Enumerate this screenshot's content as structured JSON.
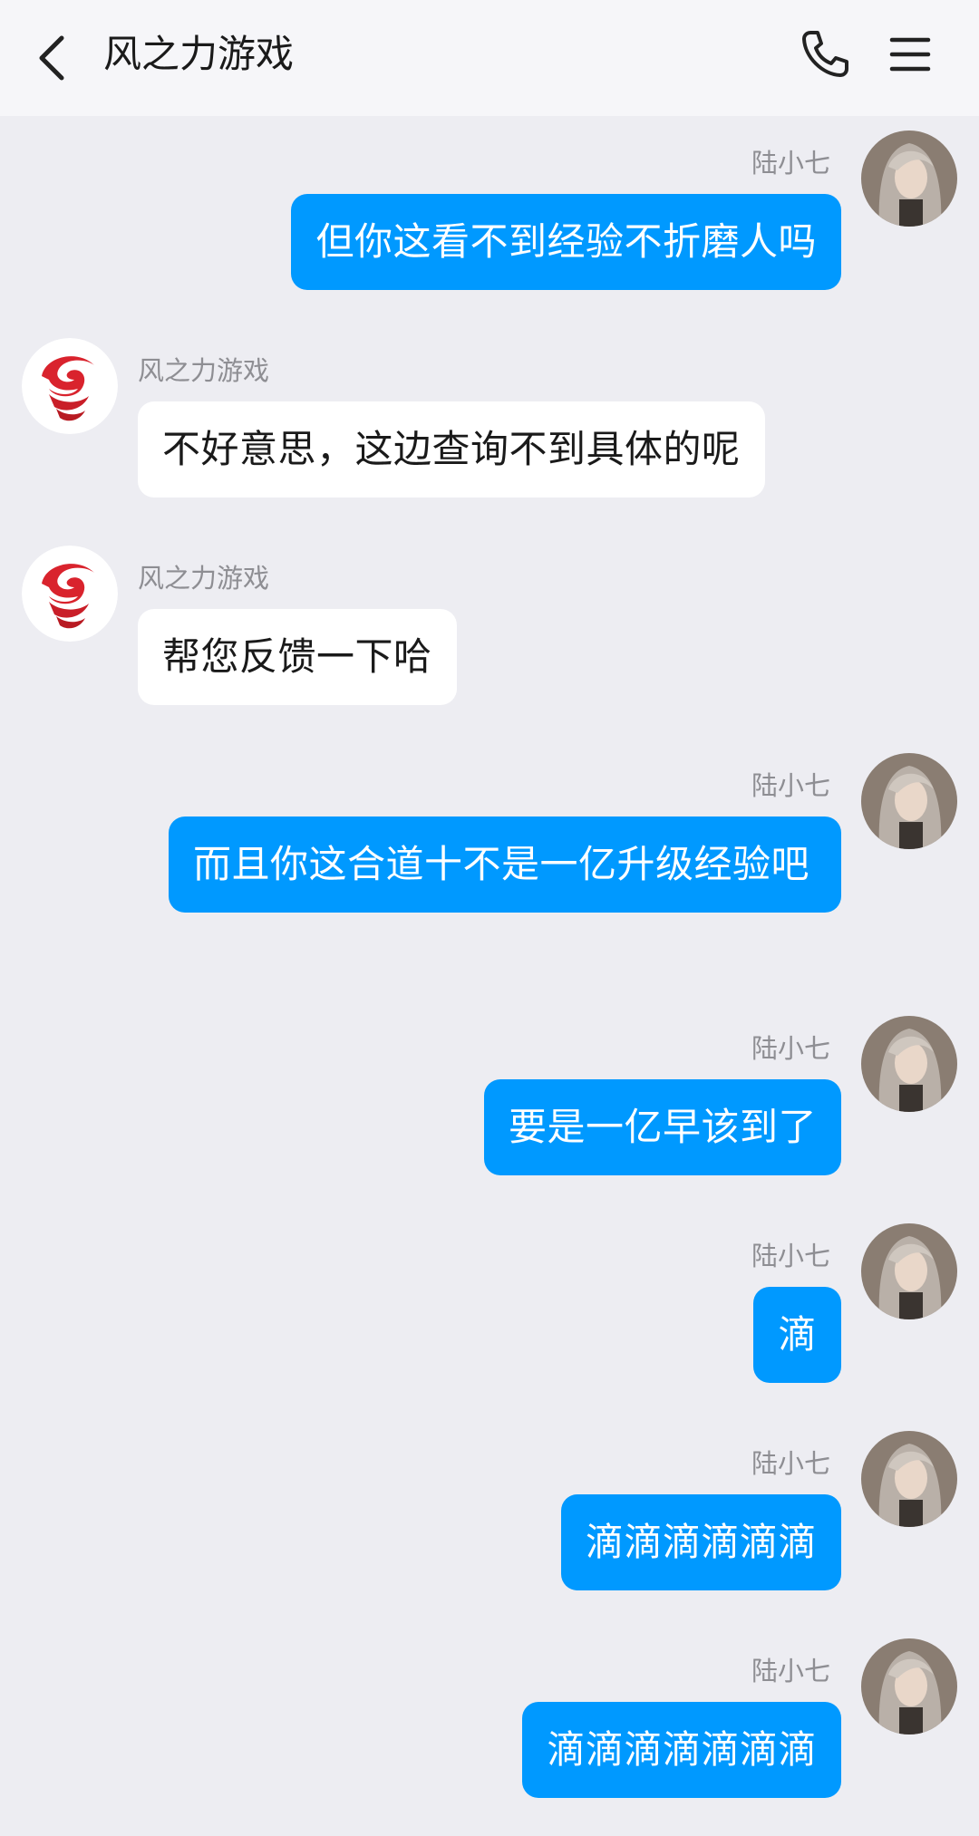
{
  "header": {
    "title": "风之力游戏",
    "back_icon": "chevron-left-icon",
    "call_icon": "phone-icon",
    "menu_icon": "menu-icon"
  },
  "contact": {
    "name": "风之力游戏",
    "avatar": "red-swirl-logo"
  },
  "me": {
    "name": "陆小七",
    "avatar": "anime-girl-avatar"
  },
  "messages": [
    {
      "side": "out",
      "sender": "陆小七",
      "text": "但你这看不到经验不折磨人吗"
    },
    {
      "side": "in",
      "sender": "风之力游戏",
      "text": "不好意思，这边查询不到具体的呢"
    },
    {
      "side": "in",
      "sender": "风之力游戏",
      "text": "帮您反馈一下哈"
    },
    {
      "side": "out",
      "sender": "陆小七",
      "text": "而且你这合道十不是一亿升级经验吧"
    },
    {
      "side": "out",
      "sender": "陆小七",
      "text": "要是一亿早该到了"
    },
    {
      "side": "out",
      "sender": "陆小七",
      "text": "滴"
    },
    {
      "side": "out",
      "sender": "陆小七",
      "text": "滴滴滴滴滴滴"
    },
    {
      "side": "out",
      "sender": "陆小七",
      "text": "滴滴滴滴滴滴滴"
    }
  ],
  "colors": {
    "background": "#ededf2",
    "header": "#f6f6f9",
    "outgoing_bubble": "#0099ff",
    "incoming_bubble": "#ffffff",
    "brand_red": "#d9232d"
  }
}
